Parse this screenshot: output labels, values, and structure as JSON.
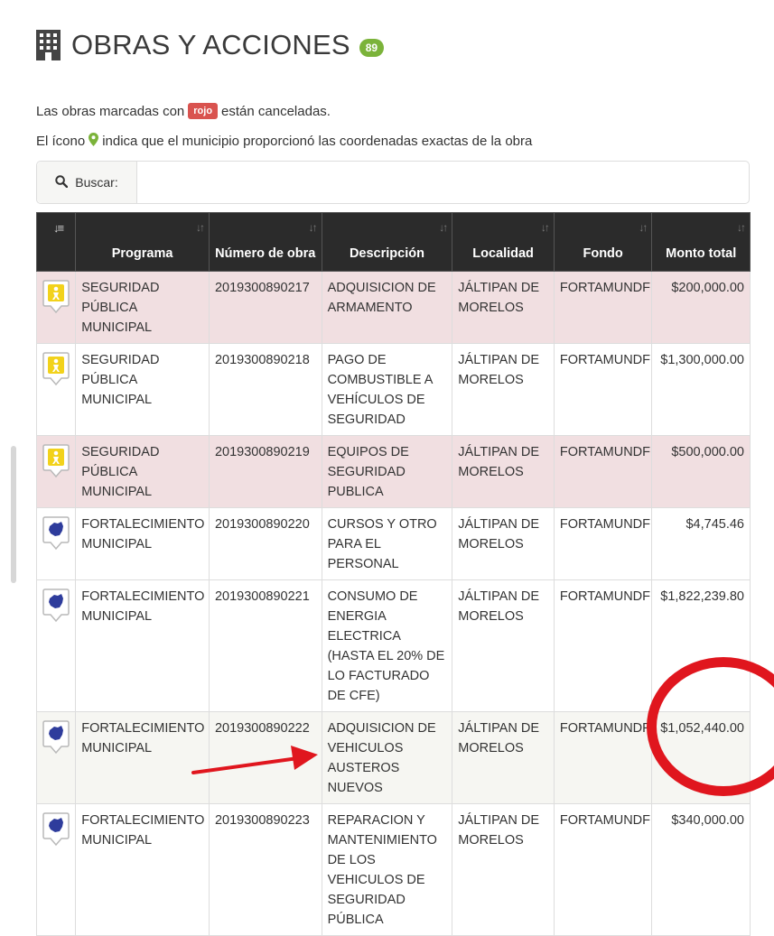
{
  "header": {
    "title": "OBRAS Y ACCIONES",
    "count": "89"
  },
  "notes": {
    "line1_before": "Las obras marcadas con",
    "line1_badge": "rojo",
    "line1_after": "están canceladas.",
    "line2_before": "El ícono",
    "line2_after": "indica que el municipio proporcionó las coordenadas exactas de la obra"
  },
  "search": {
    "label": "Buscar:",
    "value": ""
  },
  "table": {
    "columns": [
      "Programa",
      "Número de obra",
      "Descripción",
      "Localidad",
      "Fondo",
      "Monto total"
    ],
    "rows": [
      {
        "icon": "security-badge-icon",
        "programa": "SEGURIDAD PÚBLICA MUNICIPAL",
        "numero": "2019300890217",
        "descripcion": "ADQUISICION DE ARMAMENTO",
        "localidad": "JÁLTIPAN DE MORELOS",
        "fondo": "FORTAMUNDF",
        "monto": "$200,000.00",
        "status": "cancel"
      },
      {
        "icon": "security-badge-icon",
        "programa": "SEGURIDAD PÚBLICA MUNICIPAL",
        "numero": "2019300890218",
        "descripcion": "PAGO DE COMBUSTIBLE A VEHÍCULOS DE SEGURIDAD",
        "localidad": "JÁLTIPAN DE MORELOS",
        "fondo": "FORTAMUNDF",
        "monto": "$1,300,000.00",
        "status": "plain"
      },
      {
        "icon": "security-badge-icon",
        "programa": "SEGURIDAD PÚBLICA MUNICIPAL",
        "numero": "2019300890219",
        "descripcion": "EQUIPOS DE SEGURIDAD PUBLICA",
        "localidad": "JÁLTIPAN DE MORELOS",
        "fondo": "FORTAMUNDF",
        "monto": "$500,000.00",
        "status": "cancel"
      },
      {
        "icon": "municipal-badge-icon",
        "programa": "FORTALECIMIENTO MUNICIPAL",
        "numero": "2019300890220",
        "descripcion": "CURSOS Y OTRO PARA EL PERSONAL",
        "localidad": "JÁLTIPAN DE MORELOS",
        "fondo": "FORTAMUNDF",
        "monto": "$4,745.46",
        "status": "plain"
      },
      {
        "icon": "municipal-badge-icon",
        "programa": "FORTALECIMIENTO MUNICIPAL",
        "numero": "2019300890221",
        "descripcion": "CONSUMO DE ENERGIA ELECTRICA (HASTA EL 20% DE LO FACTURADO DE CFE)",
        "localidad": "JÁLTIPAN DE MORELOS",
        "fondo": "FORTAMUNDF",
        "monto": "$1,822,239.80",
        "status": "plain"
      },
      {
        "icon": "municipal-badge-icon",
        "programa": "FORTALECIMIENTO MUNICIPAL",
        "numero": "2019300890222",
        "descripcion": "ADQUISICION DE VEHICULOS AUSTEROS NUEVOS",
        "localidad": "JÁLTIPAN DE MORELOS",
        "fondo": "FORTAMUNDF",
        "monto": "$1,052,440.00",
        "status": "alt"
      },
      {
        "icon": "municipal-badge-icon",
        "programa": "FORTALECIMIENTO MUNICIPAL",
        "numero": "2019300890223",
        "descripcion": "REPARACION Y MANTENIMIENTO DE LOS VEHICULOS DE SEGURIDAD PÚBLICA",
        "localidad": "JÁLTIPAN DE MORELOS",
        "fondo": "FORTAMUNDF",
        "monto": "$340,000.00",
        "status": "plain"
      }
    ]
  },
  "colors": {
    "cancelled_row": "#f1dfe1",
    "header_bg": "#2b2b2b",
    "badge_green": "#7bb33a",
    "badge_red": "#d9534f",
    "annotation_red": "#e0161e",
    "security_yellow": "#f2d21b",
    "municipal_blue": "#2e3c9c"
  }
}
